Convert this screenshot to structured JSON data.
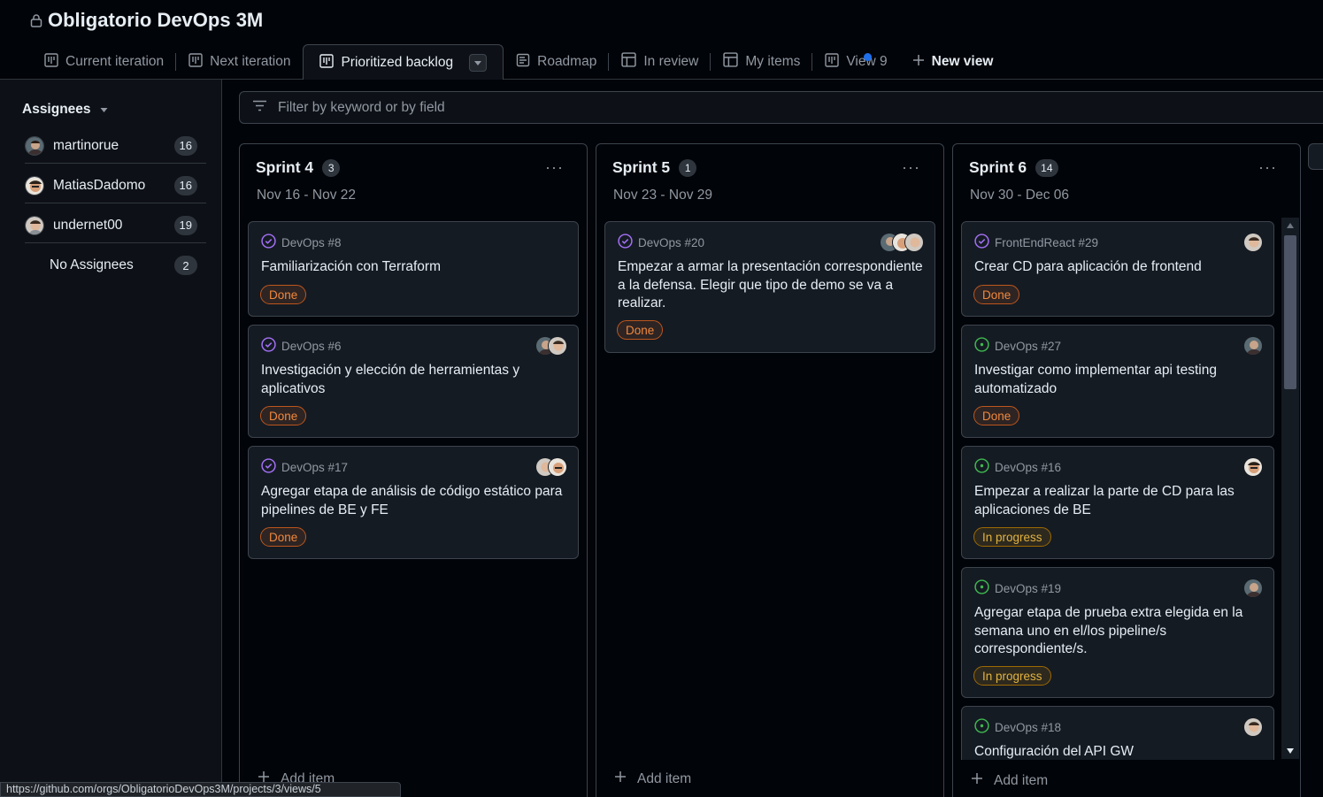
{
  "project": {
    "title": "Obligatorio DevOps 3M"
  },
  "tabs": [
    {
      "label": "Current iteration",
      "icon": "board-icon"
    },
    {
      "label": "Next iteration",
      "icon": "board-icon"
    },
    {
      "label": "Prioritized backlog",
      "icon": "board-icon",
      "active": true
    },
    {
      "label": "Roadmap",
      "icon": "roadmap-icon"
    },
    {
      "label": "In review",
      "icon": "table-icon"
    },
    {
      "label": "My items",
      "icon": "table-icon"
    },
    {
      "label": "View 9",
      "icon": "board-icon"
    },
    {
      "label": "New view",
      "icon": "plus-icon"
    }
  ],
  "sidebar": {
    "header": "Assignees",
    "items": [
      {
        "name": "martinorue",
        "count": "16"
      },
      {
        "name": "MatiasDadomo",
        "count": "16"
      },
      {
        "name": "undernet00",
        "count": "19"
      },
      {
        "name": "No Assignees",
        "count": "2"
      }
    ]
  },
  "filter": {
    "placeholder": "Filter by keyword or by field"
  },
  "columns": [
    {
      "name": "Sprint 4",
      "count": "3",
      "dates": "Nov 16 - Nov 22",
      "add_label": "Add item",
      "cards": [
        {
          "ref": "DevOps #8",
          "title": "Familiarización con Terraform",
          "status": "Done"
        },
        {
          "ref": "DevOps #6",
          "title": "Investigación y elección de herramientas y aplicativos",
          "status": "Done"
        },
        {
          "ref": "DevOps #17",
          "title": "Agregar etapa de análisis de código estático para pipelines de BE y FE",
          "status": "Done"
        }
      ]
    },
    {
      "name": "Sprint 5",
      "count": "1",
      "dates": "Nov 23 - Nov 29",
      "add_label": "Add item",
      "cards": [
        {
          "ref": "DevOps #20",
          "title": "Empezar a armar la presentación correspondiente a la defensa. Elegir que tipo de demo se va a realizar.",
          "status": "Done"
        }
      ]
    },
    {
      "name": "Sprint 6",
      "count": "14",
      "dates": "Nov 30 - Dec 06",
      "add_label": "Add item",
      "cards": [
        {
          "ref": "FrontEndReact #29",
          "title": "Crear CD para aplicación de frontend",
          "status": "Done"
        },
        {
          "ref": "DevOps #27",
          "title": "Investigar como implementar api testing automatizado",
          "status": "Done"
        },
        {
          "ref": "DevOps #16",
          "title": "Empezar a realizar la parte de CD para las aplicaciones de BE",
          "status": "In progress"
        },
        {
          "ref": "DevOps #19",
          "title": "Agregar etapa de prueba extra elegida en la semana uno en el/los pipeline/s correspondiente/s.",
          "status": "In progress"
        },
        {
          "ref": "DevOps #18",
          "title": "Configuración del API GW",
          "status": ""
        }
      ]
    }
  ],
  "status_bar": {
    "url": "https://github.com/orgs/ObligatorioDevOps3M/projects/3/views/5"
  },
  "colors": {
    "done": "#f0883e",
    "in_progress": "#e3b341",
    "closed_icon": "#a371f7",
    "open_icon": "#3fb950",
    "accent": "#1f6feb"
  }
}
